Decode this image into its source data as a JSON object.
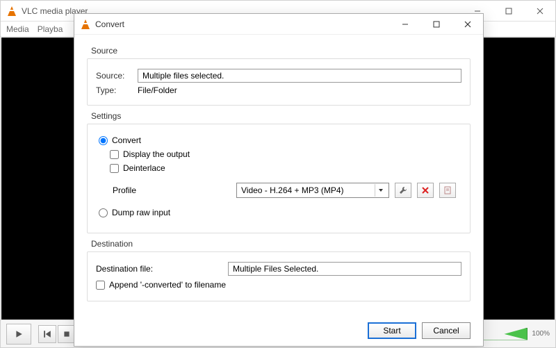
{
  "main": {
    "title": "VLC media player",
    "menu": [
      "Media",
      "Playba"
    ],
    "time": "",
    "volume_pct": "100%"
  },
  "dialog": {
    "title": "Convert",
    "sections": {
      "source": {
        "heading": "Source",
        "source_label": "Source:",
        "source_value": "Multiple files selected.",
        "type_label": "Type:",
        "type_value": "File/Folder"
      },
      "settings": {
        "heading": "Settings",
        "convert_radio": "Convert",
        "display_output": "Display the output",
        "deinterlace": "Deinterlace",
        "profile_label": "Profile",
        "profile_value": "Video - H.264 + MP3 (MP4)",
        "dump_radio": "Dump raw input"
      },
      "destination": {
        "heading": "Destination",
        "dest_label": "Destination file:",
        "dest_value": "Multiple Files Selected.",
        "append_label": "Append '-converted' to filename"
      }
    },
    "buttons": {
      "start": "Start",
      "cancel": "Cancel"
    }
  },
  "icons": {
    "wrench": "wrench-icon",
    "delete_x": "delete-icon",
    "new_profile": "new-profile-icon",
    "speaker": "speaker-icon"
  }
}
